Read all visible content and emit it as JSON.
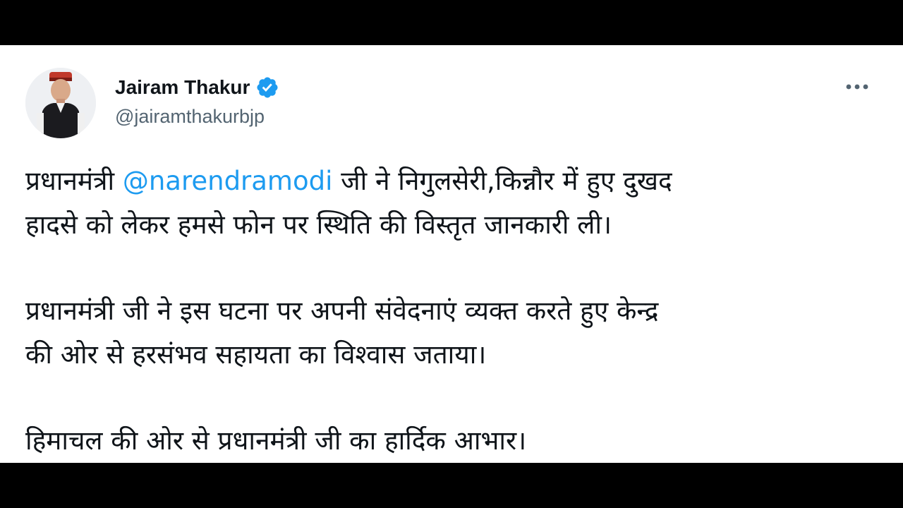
{
  "tweet": {
    "author": {
      "display_name": "Jairam Thakur",
      "handle": "@jairamthakurbjp",
      "verified_icon": "verified-badge-icon"
    },
    "more_icon": "more-options-icon",
    "paragraph1": {
      "line1_prefix": "प्रधानमंत्री ",
      "mention": "@narendramodi",
      "line1_suffix": " जी ने निगुलसेरी,किन्नौर में हुए दुखद",
      "line2": "हादसे को लेकर हमसे फोन पर स्थिति की विस्तृत जानकारी ली।"
    },
    "paragraph2": {
      "line1": "प्रधानमंत्री जी ने इस घटना पर अपनी संवेदनाएं व्यक्त करते हुए केन्द्र",
      "line2": "की ओर से हरसंभव सहायता का विश्वास जताया।"
    },
    "paragraph3": {
      "line1": "हिमाचल की ओर से प्रधानमंत्री जी का हार्दिक आभार।"
    }
  },
  "colors": {
    "background_bars": "#000000",
    "card": "#ffffff",
    "text": "#0f1419",
    "secondary_text": "#536471",
    "link": "#1d9bf0"
  }
}
